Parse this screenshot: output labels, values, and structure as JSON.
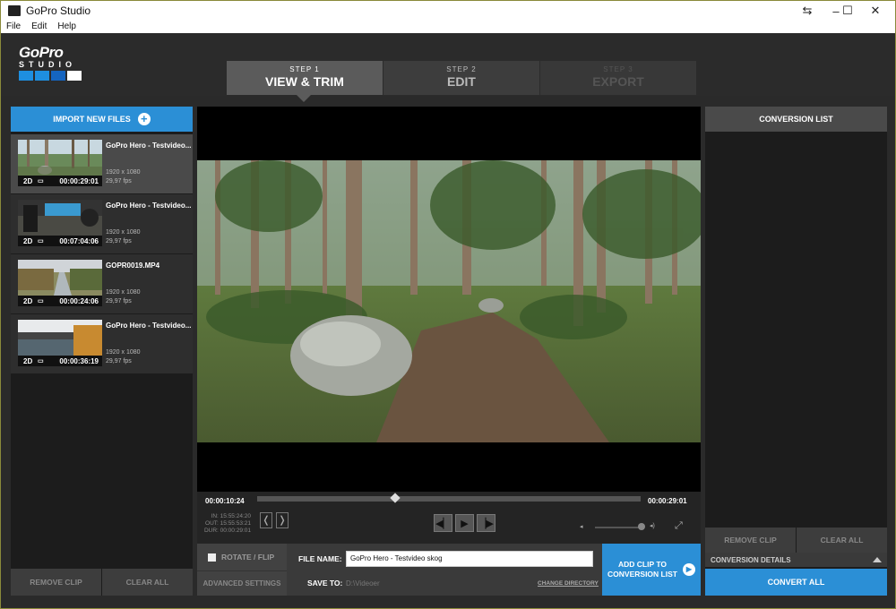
{
  "window": {
    "title": "GoPro Studio",
    "controls": [
      "⇆",
      "–",
      "☐",
      "✕"
    ]
  },
  "menu": [
    "File",
    "Edit",
    "Help"
  ],
  "logo": {
    "line1": "GoPro",
    "line2": "STUDIO",
    "colors": [
      "#1e8fe0",
      "#1e8fe0",
      "#1565c0",
      "#ffffff"
    ]
  },
  "steps": [
    {
      "number": "STEP 1",
      "label": "VIEW & TRIM"
    },
    {
      "number": "STEP 2",
      "label": "EDIT"
    },
    {
      "number": "STEP 3",
      "label": "EXPORT"
    }
  ],
  "left": {
    "import_label": "IMPORT NEW FILES",
    "clips": [
      {
        "name": "GoPro Hero - Testvideo...",
        "resolution": "1920 x 1080",
        "fps": "29,97 fps",
        "mode": "2D",
        "duration": "00:00:29:01"
      },
      {
        "name": "GoPro Hero - Testvideo...",
        "resolution": "1920 x 1080",
        "fps": "29,97 fps",
        "mode": "2D",
        "duration": "00:07:04:06"
      },
      {
        "name": "GOPR0019.MP4",
        "resolution": "1920 x 1080",
        "fps": "29,97 fps",
        "mode": "2D",
        "duration": "00:00:24:06"
      },
      {
        "name": "GoPro Hero - Testvideo...",
        "resolution": "1920 x 1080",
        "fps": "29,97 fps",
        "mode": "2D",
        "duration": "00:00:36:19"
      }
    ],
    "remove_clip": "REMOVE CLIP",
    "clear_all": "CLEAR ALL"
  },
  "player": {
    "current_time": "00:00:10:24",
    "end_time": "00:00:29:01",
    "in": "IN: 15:55:24:20",
    "out": "OUT: 15:55:53:21",
    "dur": "DUR: 00:00:29:01",
    "scrub_progress": 0.36
  },
  "bottom": {
    "rotate_flip": "ROTATE / FLIP",
    "advanced": "ADVANCED SETTINGS",
    "file_name_label": "FILE NAME:",
    "file_name_value": "GoPro Hero - Testvideo skog",
    "save_to_label": "SAVE TO:",
    "save_to_value": "D:\\Videoer",
    "change_dir": "CHANGE DIRECTORY",
    "add_clip_line1": "ADD CLIP TO",
    "add_clip_line2": "CONVERSION LIST"
  },
  "right": {
    "header": "CONVERSION LIST",
    "remove_clip": "REMOVE CLIP",
    "clear_all": "CLEAR ALL",
    "details": "CONVERSION DETAILS",
    "convert_all": "CONVERT ALL"
  }
}
